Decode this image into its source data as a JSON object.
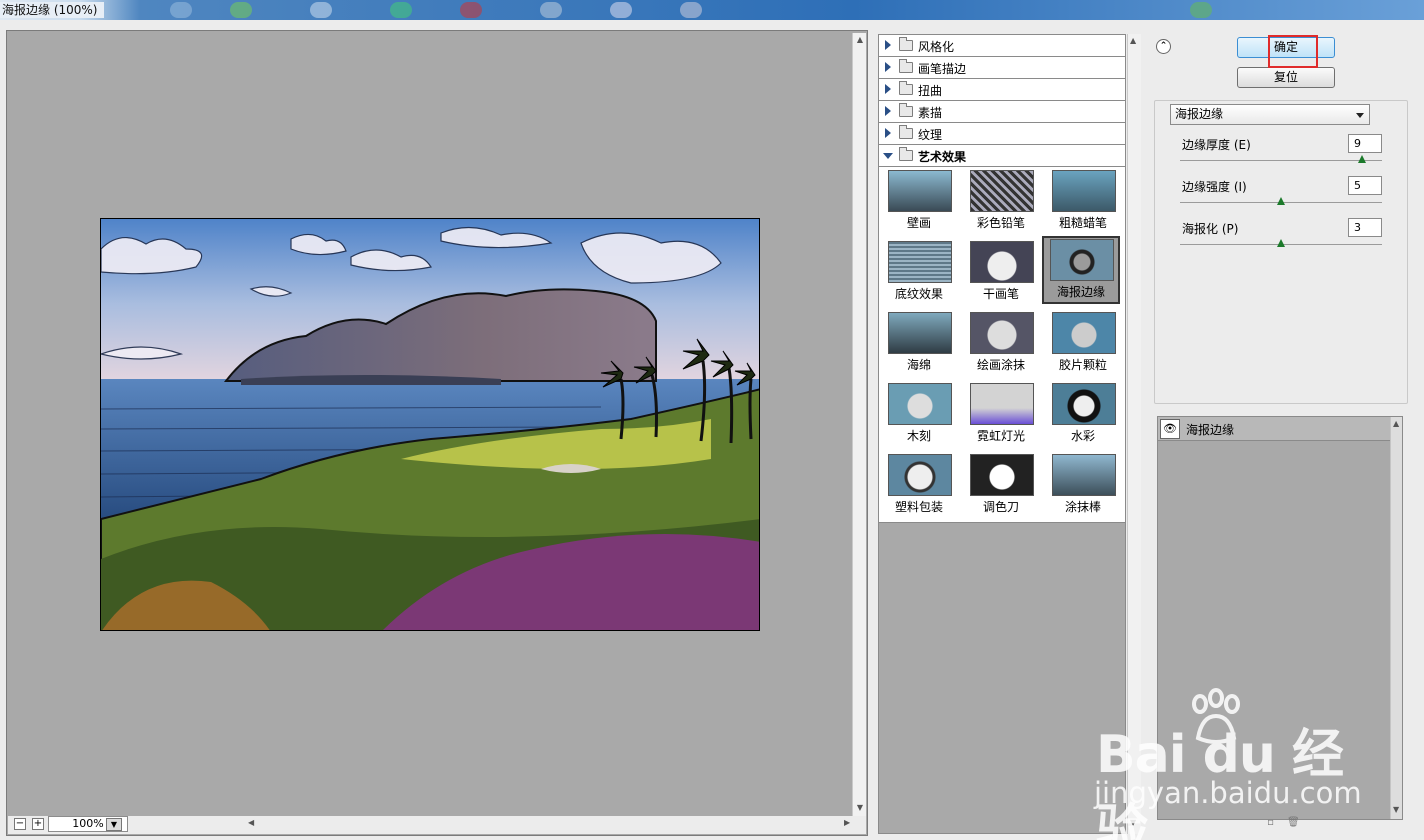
{
  "window": {
    "title": "海报边缘 (100%)"
  },
  "preview": {
    "zoom": "100%"
  },
  "categories": [
    {
      "label": "风格化",
      "open": false
    },
    {
      "label": "画笔描边",
      "open": false
    },
    {
      "label": "扭曲",
      "open": false
    },
    {
      "label": "素描",
      "open": false
    },
    {
      "label": "纹理",
      "open": false
    },
    {
      "label": "艺术效果",
      "open": true
    }
  ],
  "filters": [
    {
      "label": "壁画"
    },
    {
      "label": "彩色铅笔"
    },
    {
      "label": "粗糙蜡笔"
    },
    {
      "label": "底纹效果"
    },
    {
      "label": "干画笔"
    },
    {
      "label": "海报边缘",
      "selected": true
    },
    {
      "label": "海绵"
    },
    {
      "label": "绘画涂抹"
    },
    {
      "label": "胶片颗粒"
    },
    {
      "label": "木刻"
    },
    {
      "label": "霓虹灯光"
    },
    {
      "label": "水彩"
    },
    {
      "label": "塑料包装"
    },
    {
      "label": "调色刀"
    },
    {
      "label": "涂抹棒"
    }
  ],
  "buttons": {
    "ok": "确定",
    "reset": "复位"
  },
  "settings": {
    "selected_filter": "海报边缘",
    "params": [
      {
        "label": "边缘厚度 (E)",
        "value": "9",
        "min": 0,
        "max": 10,
        "level": 9
      },
      {
        "label": "边缘强度 (I)",
        "value": "5",
        "min": 0,
        "max": 10,
        "level": 5
      },
      {
        "label": "海报化 (P)",
        "value": "3",
        "min": 0,
        "max": 6,
        "level": 3
      }
    ]
  },
  "layers": {
    "effect_layer": "海报边缘"
  },
  "watermark": {
    "brand": "Bai du 经验",
    "url": "jingyan.baidu.com"
  },
  "colors": {
    "accent_ok": "#bfe3f8",
    "highlight_box": "#e02b2b",
    "slider_knob": "#1c7a2b"
  }
}
